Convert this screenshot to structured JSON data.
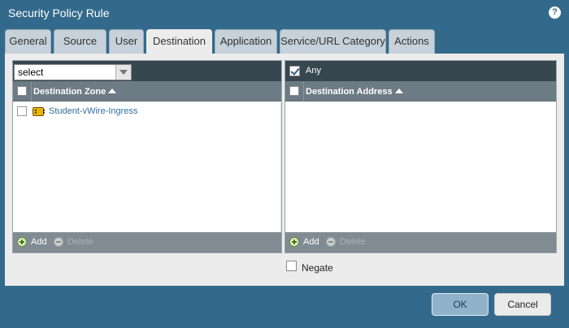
{
  "window": {
    "title": "Security Policy Rule",
    "help_icon": "?"
  },
  "tabs": [
    {
      "label": "General"
    },
    {
      "label": "Source"
    },
    {
      "label": "User"
    },
    {
      "label": "Destination",
      "active": true
    },
    {
      "label": "Application"
    },
    {
      "label": "Service/URL Category"
    },
    {
      "label": "Actions"
    }
  ],
  "zone_panel": {
    "select_value": "select",
    "header": "Destination Zone",
    "rows": [
      {
        "label": "Student-vWire-Ingress",
        "icon": "zone-icon"
      }
    ],
    "footer": {
      "add": "Add",
      "delete": "Delete"
    }
  },
  "address_panel": {
    "any_label": "Any",
    "any_checked": true,
    "header": "Destination Address",
    "rows": [],
    "footer": {
      "add": "Add",
      "delete": "Delete"
    }
  },
  "negate": {
    "label": "Negate",
    "checked": false
  },
  "buttons": {
    "ok": "OK",
    "cancel": "Cancel"
  },
  "colors": {
    "background": "#336a8c",
    "tab_active": "#ececec",
    "toolbar": "#374750",
    "header": "#6d7b84"
  }
}
